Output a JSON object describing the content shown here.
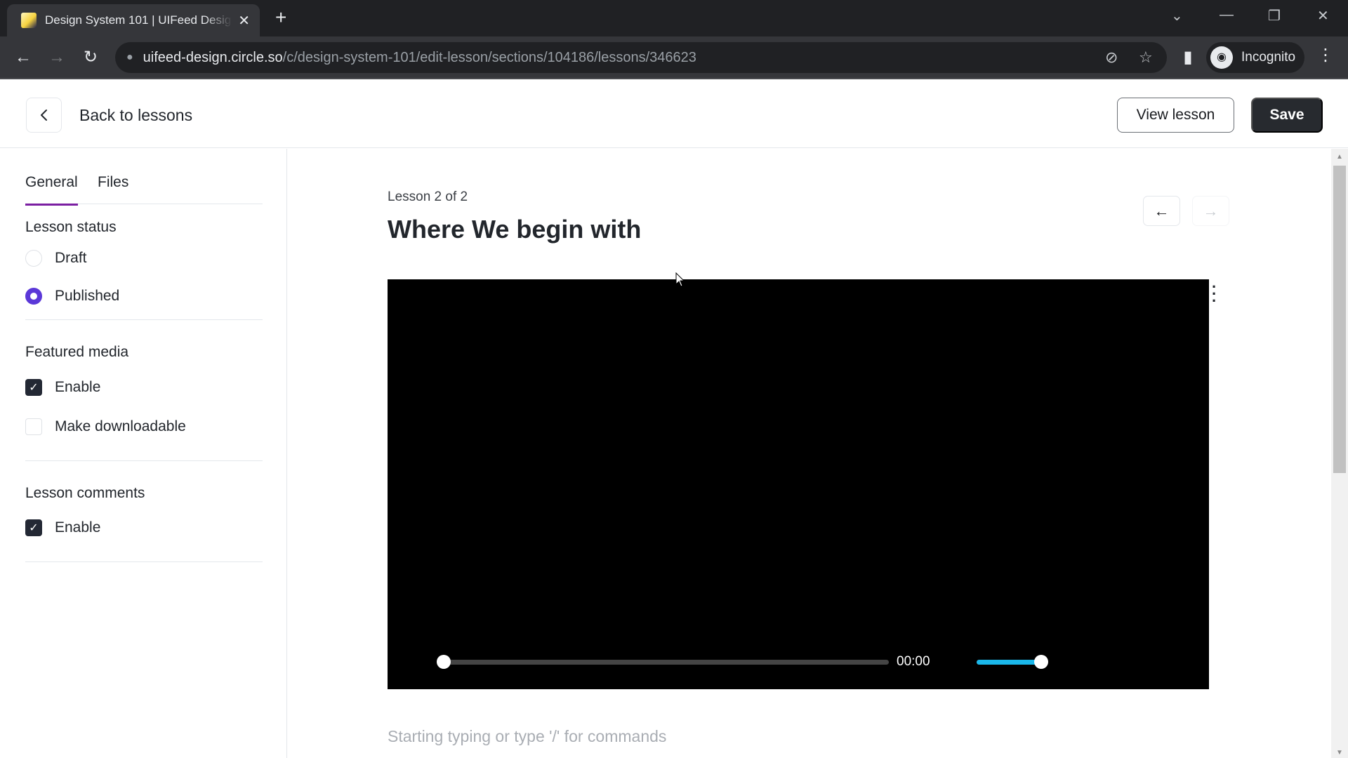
{
  "browser": {
    "tab_title": "Design System 101 | UIFeed Design",
    "tab_close": "✕",
    "new_tab": "+",
    "url_host": "uifeed-design.circle.so",
    "url_path": "/c/design-system-101/edit-lesson/sections/104186/lessons/346623",
    "profile_label": "Incognito",
    "icons": {
      "back": "←",
      "forward": "→",
      "reload": "↻",
      "lock": "🔒",
      "eye_off": "⊘",
      "star": "☆",
      "sidepanel": "▮",
      "incognito": "🕶",
      "menu": "⋮",
      "tab_search": "⌄",
      "minimize": "—",
      "restore": "❐",
      "close": "✕"
    }
  },
  "header": {
    "back_icon": "‹",
    "back_label": "Back to lessons",
    "view_lesson_label": "View lesson",
    "save_label": "Save"
  },
  "sidebar": {
    "tabs": [
      {
        "label": "General",
        "active": true
      },
      {
        "label": "Files",
        "active": false
      }
    ],
    "lesson_status": {
      "title": "Lesson status",
      "options": [
        {
          "label": "Draft",
          "selected": false
        },
        {
          "label": "Published",
          "selected": true
        }
      ]
    },
    "featured_media": {
      "title": "Featured media",
      "options": [
        {
          "label": "Enable",
          "checked": true
        },
        {
          "label": "Make downloadable",
          "checked": false
        }
      ]
    },
    "lesson_comments": {
      "title": "Lesson comments",
      "options": [
        {
          "label": "Enable",
          "checked": true
        }
      ]
    },
    "check_glyph": "✓"
  },
  "main": {
    "breadcrumb": "Lesson 2 of 2",
    "title": "Where We begin with",
    "prev_icon": "←",
    "next_icon": "→",
    "kebab_icon": "⋮",
    "video": {
      "time": "00:00",
      "progress_fraction": 0.0,
      "volume_fraction": 1.0,
      "accent_color": "#1ab7ea"
    },
    "editor_placeholder": "Starting typing or type '/' for commands"
  },
  "colors": {
    "tab_underline": "#7b1fa2",
    "radio_selected": "#5b38d8",
    "checkbox_checked": "#232834",
    "save_bg": "#272a2f"
  },
  "scrollbar": {
    "up": "▲",
    "down": "▼"
  }
}
